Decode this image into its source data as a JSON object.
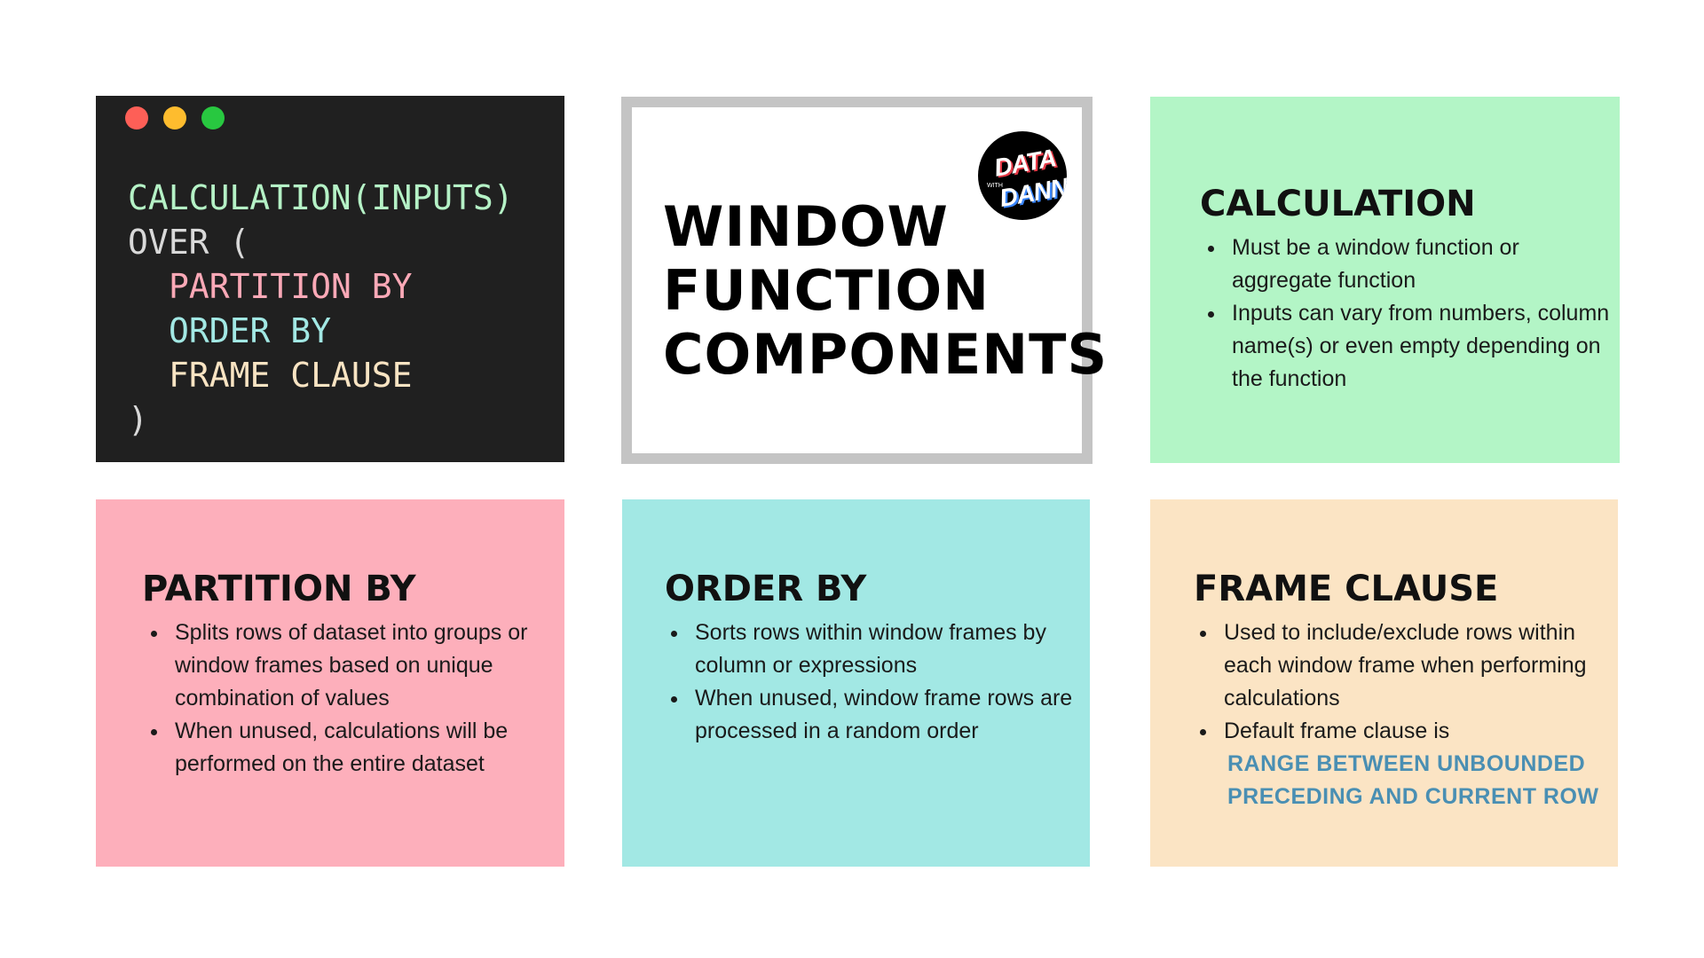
{
  "code_panel": {
    "dot_colors": [
      "#fe5f57",
      "#febc2e",
      "#28c840"
    ],
    "lines": [
      {
        "text": "CALCULATION(INPUTS)",
        "color": "#b5f2c6"
      },
      {
        "text": "OVER (",
        "color": "#d9d9d9"
      },
      {
        "text": "PARTITION BY",
        "color": "#fca9b7"
      },
      {
        "text": "ORDER BY",
        "color": "#a2e8e4"
      },
      {
        "text": "FRAME CLAUSE",
        "color": "#f9e4c3"
      },
      {
        "text": ")",
        "color": "#d9d9d9"
      }
    ]
  },
  "title_panel": {
    "lines": [
      "WINDOW",
      "FUNCTION",
      "COMPONENTS"
    ],
    "logo": {
      "line1": "DATA",
      "line2": "DANNY",
      "small": "WITH"
    }
  },
  "calculation": {
    "title": "CALCULATION",
    "color": "#b3f5c6",
    "bullets": [
      "Must be a window function or aggregate function",
      "Inputs can vary from numbers, column name(s) or even empty depending on the function"
    ]
  },
  "partition_by": {
    "title": "PARTITION BY",
    "color": "#fdafbb",
    "bullets": [
      "Splits rows of dataset into groups or window frames based on unique combination of values",
      "When unused, calculations will be performed on the entire dataset"
    ]
  },
  "order_by": {
    "title": "ORDER BY",
    "color": "#a2e8e4",
    "bullets": [
      "Sorts rows within window frames by column or expressions",
      "When unused, window frame rows are processed in a random order"
    ]
  },
  "frame_clause": {
    "title": "FRAME CLAUSE",
    "color": "#fbe4c4",
    "bullets": [
      "Used to include/exclude rows within each window frame when performing calculations",
      "Default frame clause is"
    ],
    "highlight": "RANGE BETWEEN UNBOUNDED PRECEDING AND CURRENT ROW",
    "highlight_color": "#4a8fb3"
  }
}
